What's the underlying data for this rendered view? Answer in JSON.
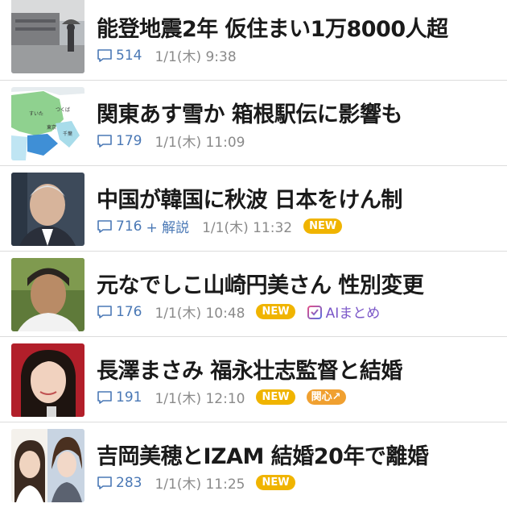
{
  "articles": [
    {
      "title": "能登地震2年 仮住まい1万8000人超",
      "comments": "514",
      "date": "1/1(木) 9:38"
    },
    {
      "title": "関東あす雪か 箱根駅伝に影響も",
      "comments": "179",
      "date": "1/1(木) 11:09"
    },
    {
      "title": "中国が韓国に秋波 日本をけん制",
      "comments": "716",
      "plus_label": "+ 解説",
      "date": "1/1(木) 11:32",
      "badge": "NEW"
    },
    {
      "title": "元なでしこ山崎円美さん 性別変更",
      "comments": "176",
      "date": "1/1(木) 10:48",
      "badge": "NEW",
      "ai_label": "AIまとめ"
    },
    {
      "title": "長澤まさみ 福永壮志監督と結婚",
      "comments": "191",
      "date": "1/1(木) 12:10",
      "badge": "NEW",
      "interest_label": "関心↗"
    },
    {
      "title": "吉岡美穂とIZAM 結婚20年で離婚",
      "comments": "283",
      "date": "1/1(木) 11:25",
      "badge": "NEW"
    }
  ],
  "thumb_labels": {
    "map": [
      "すいた",
      "つくば",
      "東京",
      "千葉"
    ]
  },
  "colors": {
    "badge_new": "#f0b400",
    "badge_interest": "#f0a030",
    "comment_count": "#4a78b5",
    "ai": "#7a56c8"
  },
  "icons": {
    "comment": "speech-bubble-icon",
    "ai": "ai-summary-icon"
  }
}
